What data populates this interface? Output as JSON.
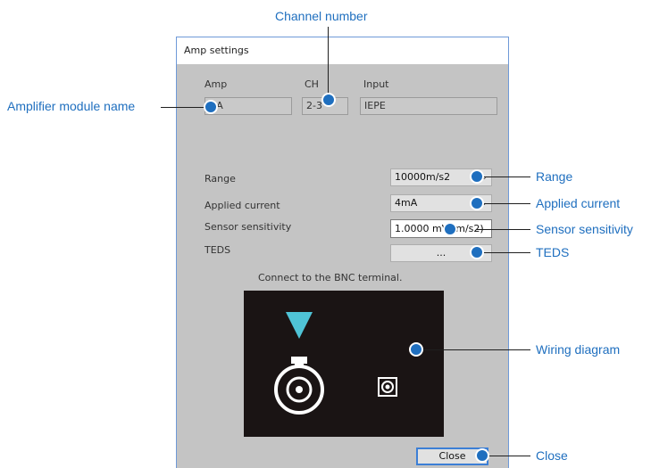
{
  "dialog": {
    "title": "Amp settings",
    "headers": {
      "amp": "Amp",
      "ch": "CH",
      "input": "Input"
    },
    "amp_value": "HA",
    "ch_value": "2-3",
    "input_value": "IEPE",
    "range": {
      "label": "Range",
      "value": "10000m/s2"
    },
    "applied_current": {
      "label": "Applied current",
      "value": "4mA"
    },
    "sensor_sensitivity": {
      "label": "Sensor sensitivity",
      "value": "1.0000 mV/(m/s2)"
    },
    "teds": {
      "label": "TEDS",
      "button": "..."
    },
    "hint": "Connect to the BNC terminal.",
    "close_button": "Close"
  },
  "callouts": {
    "channel_number": "Channel number",
    "amplifier_module_name": "Amplifier module name",
    "range": "Range",
    "applied_current": "Applied current",
    "sensor_sensitivity": "Sensor sensitivity",
    "teds": "TEDS",
    "wiring_diagram": "Wiring diagram",
    "close": "Close"
  },
  "colors": {
    "callout_blue": "#1f6fbf",
    "dialog_bg": "#c4c4c4",
    "diagram_bg": "#1a1414",
    "arrow_cyan": "#4fc3d6"
  },
  "icons": {
    "combo_arrow": "chevron-down-icon",
    "bnc": "bnc-connector-icon",
    "terminal": "terminal-icon",
    "marker": "triangle-marker-icon"
  }
}
